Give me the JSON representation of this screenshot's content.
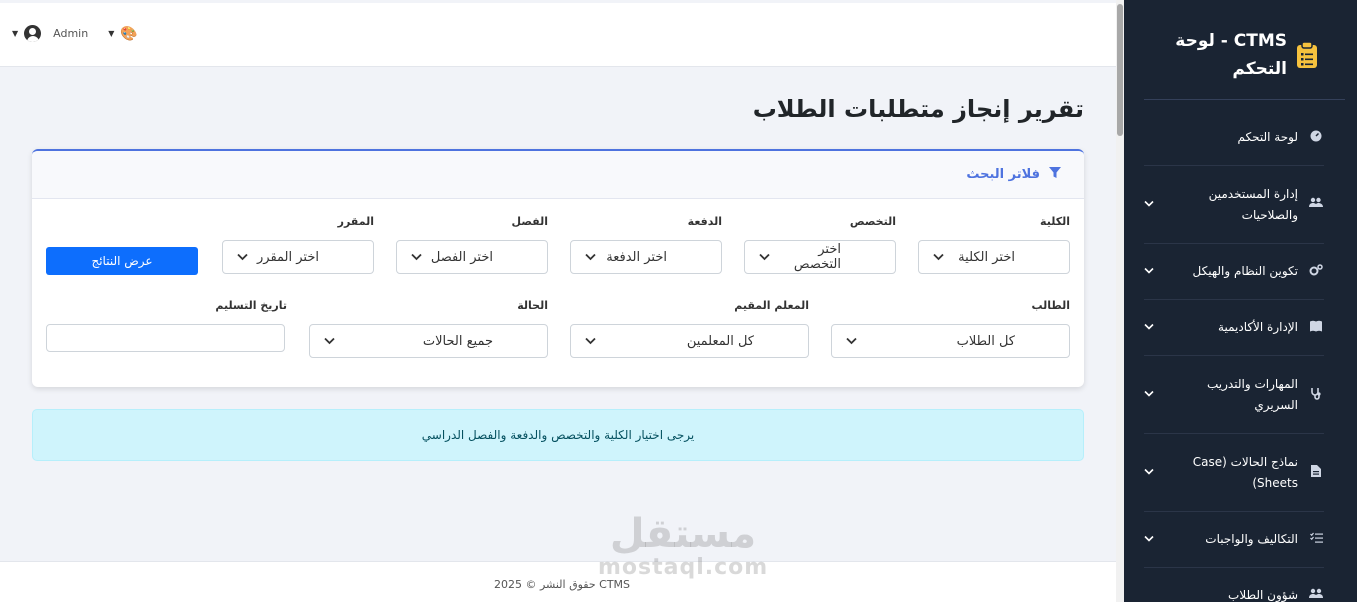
{
  "topbar": {
    "user_name": "Admin"
  },
  "sidebar": {
    "brand_line1": "CTMS - لوحة",
    "brand_line2": "التحكم",
    "items": [
      {
        "label": "لوحة التحكم",
        "icon": "dashboard-icon"
      },
      {
        "label": "إدارة المستخدمين والصلاحيات",
        "icon": "users-gear-icon"
      },
      {
        "label": "تكوين النظام والهيكل",
        "icon": "cogs-icon"
      },
      {
        "label": "الإدارة الأكاديمية",
        "icon": "book-icon"
      },
      {
        "label": "المهارات والتدريب السريري",
        "icon": "stethoscope-icon"
      },
      {
        "label": "نماذج الحالات (Case Sheets)",
        "icon": "file-icon"
      },
      {
        "label": "التكاليف والواجبات",
        "icon": "tasks-icon"
      },
      {
        "label": "شؤون الطلاب",
        "icon": "students-icon"
      }
    ]
  },
  "page": {
    "title": "تقرير إنجاز متطلبات الطلاب"
  },
  "filters": {
    "header": "فلاتر البحث",
    "college": {
      "label": "الكلية",
      "value": "اختر الكلية"
    },
    "specialty": {
      "label": "التخصص",
      "value": "اختر التخصص"
    },
    "batch": {
      "label": "الدفعة",
      "value": "اختر الدفعة"
    },
    "semester": {
      "label": "الفصل",
      "value": "اختر الفصل"
    },
    "course": {
      "label": "المقرر",
      "value": "اختر المقرر"
    },
    "show_button": "عرض النتائج",
    "student": {
      "label": "الطالب",
      "value": "كل الطلاب"
    },
    "teacher": {
      "label": "المعلم المقيم",
      "value": "كل المعلمين"
    },
    "status": {
      "label": "الحالة",
      "value": "جميع الحالات"
    },
    "delivery_date": {
      "label": "تاريخ التسليم",
      "value": ""
    }
  },
  "alert": {
    "text": "يرجى اختيار الكلية والتخصص والدفعة والفصل الدراسي"
  },
  "footer": {
    "text": "حقوق النشر © 2025 CTMS"
  },
  "watermark": {
    "ar": "مستقل",
    "en": "mostaql.com"
  }
}
